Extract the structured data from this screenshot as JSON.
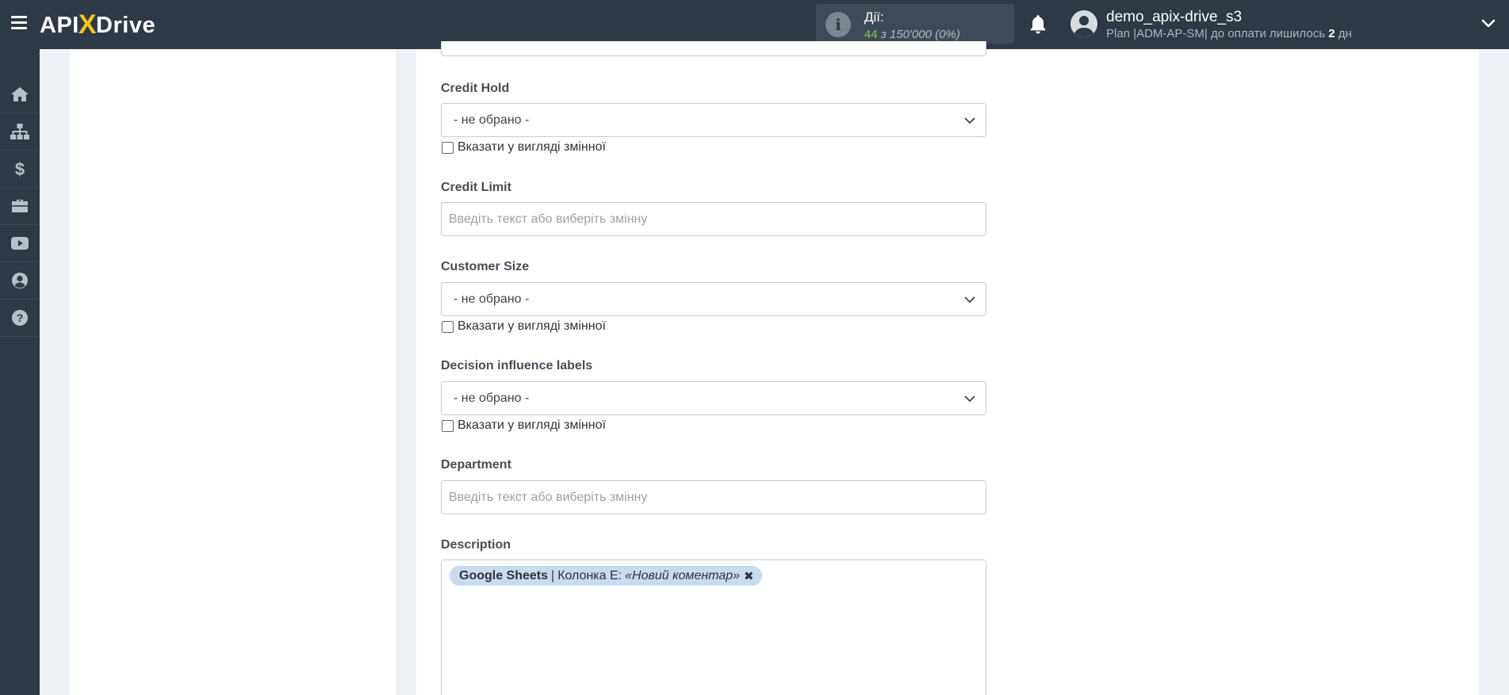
{
  "header": {
    "logo_left": "API",
    "logo_x": "X",
    "logo_right": "Drive",
    "actions_label": "Дії:",
    "actions_used": "44",
    "actions_of": "з 150'000",
    "actions_pct": "(0%)",
    "username": "demo_apix-drive_s3",
    "plan_text": "Plan |ADM-AP-SM| до оплати лишилось",
    "plan_days": "2",
    "plan_unit": "дн"
  },
  "sidebar": {
    "items": [
      {
        "icon": "home-icon"
      },
      {
        "icon": "sitemap-icon"
      },
      {
        "icon": "dollar-icon"
      },
      {
        "icon": "briefcase-icon"
      },
      {
        "icon": "video-icon"
      },
      {
        "icon": "user-icon"
      },
      {
        "icon": "help-icon"
      }
    ]
  },
  "form": {
    "credit_hold": {
      "label": "Credit Hold",
      "value": "- не обрано -",
      "checkbox_label": "Вказати у вигляді змінної"
    },
    "credit_limit": {
      "label": "Credit Limit",
      "placeholder": "Введіть текст або виберіть змінну"
    },
    "customer_size": {
      "label": "Customer Size",
      "value": "- не обрано -",
      "checkbox_label": "Вказати у вигляді змінної"
    },
    "decision_influence": {
      "label": "Decision influence labels",
      "value": "- не обрано -",
      "checkbox_label": "Вказати у вигляді змінної"
    },
    "department": {
      "label": "Department",
      "placeholder": "Введіть текст або виберіть змінну"
    },
    "description": {
      "label": "Description",
      "tag_source": "Google Sheets",
      "tag_separator": "|",
      "tag_column": "Колонка E:",
      "tag_value": "«Новий коментар»",
      "tag_remove": "✖"
    }
  }
}
